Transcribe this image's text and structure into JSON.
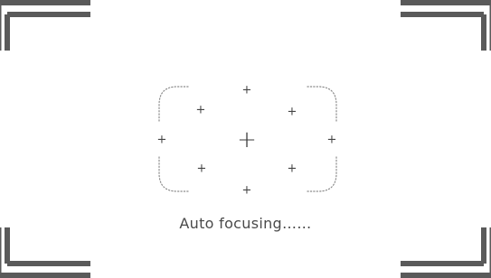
{
  "viewfinder": {
    "status_text": "Auto focusing……",
    "frame_color": "#555555",
    "bracket_color": "#8a8a8a",
    "focus_points": {
      "center_icon": "plus-icon",
      "peripheral_icon": "plus-icon",
      "count": 9,
      "glyph": "+"
    }
  }
}
